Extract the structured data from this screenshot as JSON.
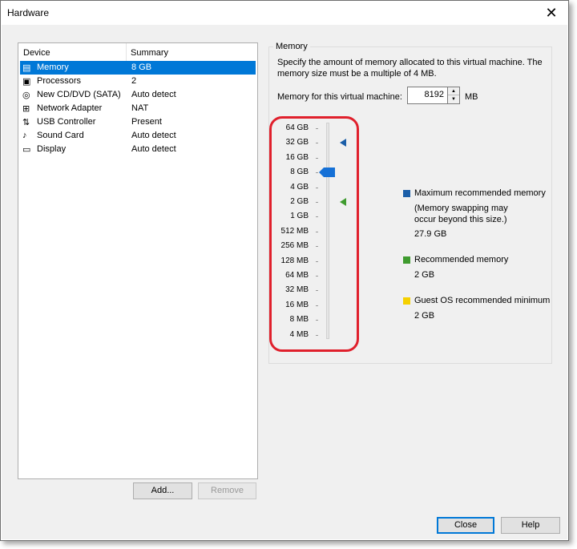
{
  "window": {
    "title": "Hardware",
    "close_glyph": "✕"
  },
  "device_list": {
    "headers": {
      "device": "Device",
      "summary": "Summary"
    },
    "items": [
      {
        "name": "Memory",
        "summary": "8 GB",
        "icon": "memory-icon",
        "selected": true
      },
      {
        "name": "Processors",
        "summary": "2",
        "icon": "processor-icon",
        "selected": false
      },
      {
        "name": "New CD/DVD (SATA)",
        "summary": "Auto detect",
        "icon": "cd-dvd-icon",
        "selected": false
      },
      {
        "name": "Network Adapter",
        "summary": "NAT",
        "icon": "network-adapter-icon",
        "selected": false
      },
      {
        "name": "USB Controller",
        "summary": "Present",
        "icon": "usb-controller-icon",
        "selected": false
      },
      {
        "name": "Sound Card",
        "summary": "Auto detect",
        "icon": "sound-card-icon",
        "selected": false
      },
      {
        "name": "Display",
        "summary": "Auto detect",
        "icon": "display-icon",
        "selected": false
      }
    ],
    "add_label": "Add...",
    "remove_label": "Remove"
  },
  "memory": {
    "group_title": "Memory",
    "description": "Specify the amount of memory allocated to this virtual machine. The memory size must be a multiple of 4 MB.",
    "field_label": "Memory for this virtual machine:",
    "value": "8192",
    "unit": "MB",
    "scale_labels": [
      "64 GB",
      "32 GB",
      "16 GB",
      "8 GB",
      "4 GB",
      "2 GB",
      "1 GB",
      "512 MB",
      "256 MB",
      "128 MB",
      "64 MB",
      "32 MB",
      "16 MB",
      "8 MB",
      "4 MB"
    ],
    "selected_label": "8 GB",
    "max_recommended_label": "32 GB",
    "recommended_label": "2 GB",
    "legend": {
      "max": {
        "title": "Maximum recommended memory",
        "note": "(Memory swapping may occur beyond this size.)",
        "value": "27.9 GB",
        "color": "#1b5ea8"
      },
      "recommended": {
        "title": "Recommended memory",
        "value": "2 GB",
        "color": "#3f9b2f"
      },
      "guest_min": {
        "title": "Guest OS recommended minimum",
        "value": "2 GB",
        "color": "#f5d000"
      }
    },
    "highlight_color": "#e0202c",
    "thumb_color": "#1570d6"
  },
  "footer": {
    "close_label": "Close",
    "help_label": "Help"
  }
}
